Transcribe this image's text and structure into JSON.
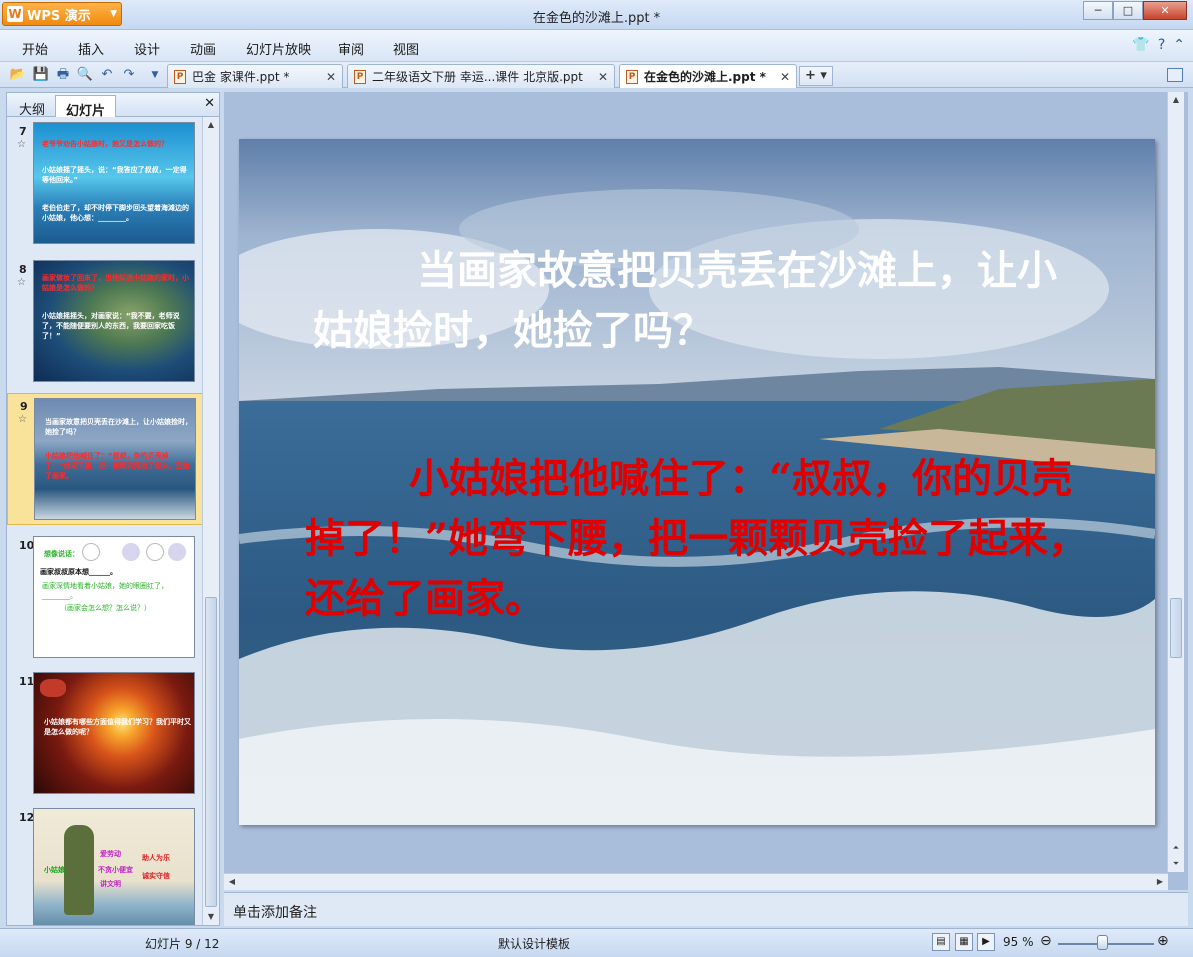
{
  "app": {
    "name": "WPS 演示",
    "window_title": "在金色的沙滩上.ppt *"
  },
  "menu": [
    "开始",
    "插入",
    "设计",
    "动画",
    "幻灯片放映",
    "审阅",
    "视图"
  ],
  "tabs": [
    {
      "label": "巴金 家课件.ppt *",
      "active": false
    },
    {
      "label": "二年级语文下册 幸运...课件 北京版.ppt",
      "active": false
    },
    {
      "label": "在金色的沙滩上.ppt *",
      "active": true
    }
  ],
  "panel": {
    "tabs": [
      "大纲",
      "幻灯片"
    ],
    "active_tab": "幻灯片"
  },
  "thumbnails": [
    {
      "num": "7",
      "lines": [
        "老爷爷劝告小姑娘时，她又是怎么做的？",
        "小姑娘摇了摇头，说：“我答应了叔叔，一定得等他回来。”",
        "老伯伯走了，却不时停下脚步回头望着海滩边的小姑娘，他心想：________。"
      ]
    },
    {
      "num": "8",
      "lines": [
        "画家做妆了回来了，当他知道小姑娘的家时，小姑娘是怎么做的？",
        "小姑娘摇摇头，对画家说：“我不要，老师说了，不能随便要别人的东西，我要回家吃饭了！”"
      ]
    },
    {
      "num": "9",
      "lines": [
        "当画家故意把贝壳丢在沙滩上，让小姑娘捡时，她捡了吗？",
        "小姑娘把他喊住了：“叔叔，你的贝壳掉了！”她弯下腰，把一颗颗贝壳捡了起来，还给了画家。"
      ]
    },
    {
      "num": "10",
      "lines": [
        "想像说话：",
        "画家叔叔原本想______。",
        "画家深情地看着小姑娘，她的眼圈红了，________。",
        "（画家会怎么想？怎么说？）"
      ]
    },
    {
      "num": "11",
      "lines": [
        "小姑娘都有哪些方面值得我们学习？我们平时又是怎么做的呢？"
      ]
    },
    {
      "num": "12",
      "lines": [
        "小姑娘",
        "爱劳动",
        "不贪小便宜",
        "讲文明",
        "助人为乐",
        "诚实守信"
      ]
    }
  ],
  "slide": {
    "question": "当画家故意把贝壳丢在沙滩上，让小姑娘捡时，她捡了吗？",
    "answer": "小姑娘把他喊住了：“叔叔，你的贝壳掉了！”她弯下腰，把一颗颗贝壳捡了起来，还给了画家。"
  },
  "notes_placeholder": "单击添加备注",
  "status": {
    "slide_counter": "幻灯片 9 / 12",
    "template": "默认设计模板",
    "zoom": "95 %"
  },
  "colors": {
    "accent_orange": "#f08a12",
    "answer_red": "#e00000",
    "selected_thumb": "#f9e39a"
  }
}
